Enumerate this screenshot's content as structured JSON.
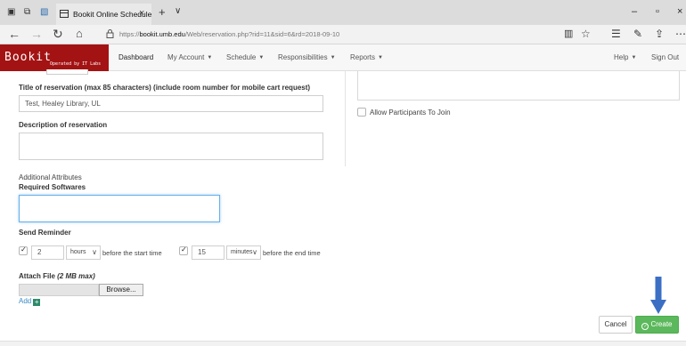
{
  "browser": {
    "tab_title": "Bookit Online Schedule",
    "url_prefix": "https://",
    "url_host": "bookit.umb.edu",
    "url_path": "/Web/reservation.php?rid=11&sid=6&rd=2018-09-10"
  },
  "app": {
    "logo_text": "Bookit",
    "logo_subtitle": "Operated by IT Labs",
    "brand_color": "#a31313",
    "nav": {
      "dashboard": "Dashboard",
      "my_account": "My Account",
      "schedule": "Schedule",
      "responsibilities": "Responsibilities",
      "reports": "Reports",
      "help": "Help",
      "sign_out": "Sign Out"
    }
  },
  "form": {
    "title_label": "Title of reservation (max 85 characters) (include room number for mobile cart request)",
    "title_value": "Test, Healey Library, UL",
    "description_label": "Description of reservation",
    "description_value": "",
    "allow_participants_label": "Allow Participants To Join",
    "additional_attributes_label": "Additional Attributes",
    "required_softwares_label": "Required Softwares",
    "required_softwares_value": "",
    "send_reminder_label": "Send Reminder",
    "reminder_start_value": "2",
    "reminder_start_unit": "hours",
    "reminder_start_suffix": "before the start time",
    "reminder_end_value": "15",
    "reminder_end_unit": "minutes",
    "reminder_end_suffix": "before the end time",
    "attach_file_label": "Attach File",
    "attach_file_hint": "(2 MB max)",
    "browse_label": "Browse...",
    "add_label": "Add"
  },
  "actions": {
    "cancel_label": "Cancel",
    "create_label": "Create",
    "create_color": "#5cb85c",
    "annotation_arrow_color": "#3b6fc4"
  }
}
